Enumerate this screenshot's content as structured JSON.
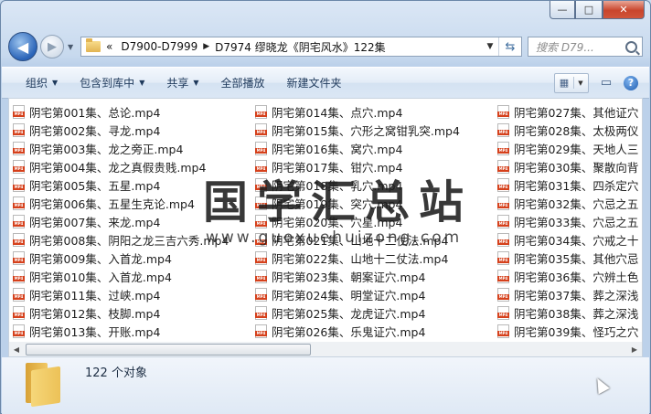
{
  "window": {
    "caption": {
      "minimize": "—",
      "maximize": "□",
      "close": "✕"
    }
  },
  "nav": {
    "back_glyph": "◀",
    "forward_glyph": "▶",
    "breadcrumb_prefix": "«",
    "crumbs": [
      "D7900-D7999",
      "D7974 缪晓龙《阴宅风水》122集"
    ],
    "crumb_sep": "▶",
    "search_placeholder": "搜索 D79...",
    "icons": {
      "folder": "folder-icon",
      "refresh": "refresh-icon",
      "search": "search-icon"
    }
  },
  "toolbar": {
    "organize": "组织",
    "include_library": "包含到库中",
    "share": "共享",
    "play_all": "全部播放",
    "new_folder": "新建文件夹"
  },
  "files": {
    "col1": [
      "阴宅第001集、总论.mp4",
      "阴宅第002集、寻龙.mp4",
      "阴宅第003集、龙之旁正.mp4",
      "阴宅第004集、龙之真假贵贱.mp4",
      "阴宅第005集、五星.mp4",
      "阴宅第006集、五星生克论.mp4",
      "阴宅第007集、来龙.mp4",
      "阴宅第008集、阴阳之龙三吉六秀.mp4",
      "阴宅第009集、入首龙.mp4",
      "阴宅第010集、入首龙.mp4",
      "阴宅第011集、过峡.mp4",
      "阴宅第012集、枝脚.mp4",
      "阴宅第013集、开账.mp4"
    ],
    "col2": [
      "阴宅第014集、点穴.mp4",
      "阴宅第015集、穴形之窝钳乳突.mp4",
      "阴宅第016集、窝穴.mp4",
      "阴宅第017集、钳穴.mp4",
      "阴宅第018集、乳穴.mp4",
      "阴宅第019集、突穴.mp4",
      "阴宅第020集、穴星.mp4",
      "阴宅第021集、山地十二仗法.mp4",
      "阴宅第022集、山地十二仗法.mp4",
      "阴宅第023集、朝案证穴.mp4",
      "阴宅第024集、明堂证穴.mp4",
      "阴宅第025集、龙虎证穴.mp4",
      "阴宅第026集、乐鬼证穴.mp4"
    ],
    "col3": [
      "阴宅第027集、其他证穴",
      "阴宅第028集、太极两仪",
      "阴宅第029集、天地人三",
      "阴宅第030集、聚散向背",
      "阴宅第031集、四杀定穴",
      "阴宅第032集、穴忌之五",
      "阴宅第033集、穴忌之五",
      "阴宅第034集、穴戒之十",
      "阴宅第035集、其他穴忌",
      "阴宅第036集、穴辨土色",
      "阴宅第037集、葬之深浅",
      "阴宅第038集、葬之深浅",
      "阴宅第039集、怪巧之穴"
    ]
  },
  "watermark": {
    "title": "国学汇总站",
    "url": "www.guoxuehuizong.com"
  },
  "details": {
    "count_text": "122 个对象"
  }
}
